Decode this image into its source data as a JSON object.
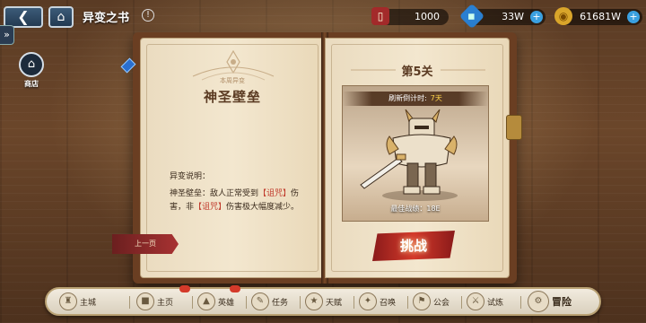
{
  "header": {
    "back_icon": "chevron-left-icon",
    "home_icon": "home-icon",
    "title": "异变之书",
    "info_icon": "info-icon"
  },
  "resources": [
    {
      "name": "red-book",
      "icon": "red-book-icon",
      "value": "1000"
    },
    {
      "name": "blue-gem",
      "icon": "blue-gem-icon",
      "value": "33W",
      "has_plus": true
    },
    {
      "name": "gold-coin",
      "icon": "gold-coin-icon",
      "value": "61681W",
      "has_plus": true
    }
  ],
  "sidebar": {
    "shop_label": "商店"
  },
  "left_page": {
    "subtitle": "本周异变",
    "title": "神圣壁垒",
    "desc_label": "异变说明：",
    "desc_part1": "神圣壁垒：敌人正常受到",
    "curse1": "【诅咒】",
    "desc_part2": "伤害，非",
    "curse2": "【诅咒】",
    "desc_part3": "伤害极大幅度减少。",
    "prev_button": "上一页"
  },
  "right_page": {
    "level_title": "第5关",
    "refresh_label": "刷新倒计时:",
    "refresh_value": "7天",
    "best_score": "最佳战绩：18E",
    "challenge_button": "挑战"
  },
  "bottom_nav": [
    {
      "name": "main-city",
      "icon": "castle-icon",
      "label": "主城"
    },
    {
      "name": "home",
      "icon": "building-icon",
      "label": "主页",
      "badge": true
    },
    {
      "name": "heroes",
      "icon": "helmet-icon",
      "label": "英雄",
      "badge": true
    },
    {
      "name": "tasks",
      "icon": "scroll-icon",
      "label": "任务"
    },
    {
      "name": "talent",
      "icon": "star-icon",
      "label": "天赋"
    },
    {
      "name": "summon",
      "icon": "summon-icon",
      "label": "召唤"
    },
    {
      "name": "guild",
      "icon": "guild-icon",
      "label": "公会"
    },
    {
      "name": "trial",
      "icon": "trial-icon",
      "label": "试炼"
    },
    {
      "name": "adventure",
      "icon": "gear-icon",
      "label": "冒险"
    }
  ],
  "colors": {
    "accent_red": "#c0392b",
    "highlight_gold": "#ffd54a",
    "page_bg": "#f3e7cf"
  }
}
